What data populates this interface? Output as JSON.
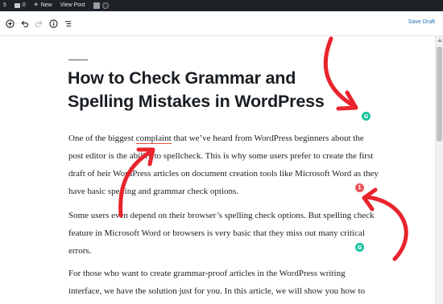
{
  "admin_bar": {
    "updates_count": "5",
    "comments_count": "0",
    "new_label": "New",
    "view_post_label": "View Post"
  },
  "toolbar": {
    "save_draft_label": "Save Draft"
  },
  "post": {
    "title_line1": "How to Check Grammar and",
    "title_line2": "Spelling Mistakes in WordPress",
    "p1_a": "One of the biggest ",
    "p1_complaint": "complaint",
    "p1_b": " that we’ve heard from WordPress beginners about the post editor is th",
    "p1_c": "e ability to spellcheck.  This is why some users prefer to create the first d",
    "p1_d": "raft of ",
    "p1_e": "heir WordPress articles on document creation tools like Microsoft W",
    "p1_f": "ord as they have basic spelling and grammar check options.",
    "p2": "Some users e",
    "p2_b": "ven depend on their browser’s spelling check options. But spelling check feature in Microsoft Word or browsers is very basic that they miss out many critical errors.",
    "p3": "For those who want to create grammar-proof articles in the WordPress writing interface, we have the solution just for you. In this article, we will show you how to"
  },
  "grammarly": {
    "badge_letter": "G",
    "issue_count": "1"
  },
  "colors": {
    "accent": "#2271b1",
    "arrow_red": "#e8242c",
    "grammarly_green": "#15c39a",
    "issue_red": "#e9575b"
  }
}
